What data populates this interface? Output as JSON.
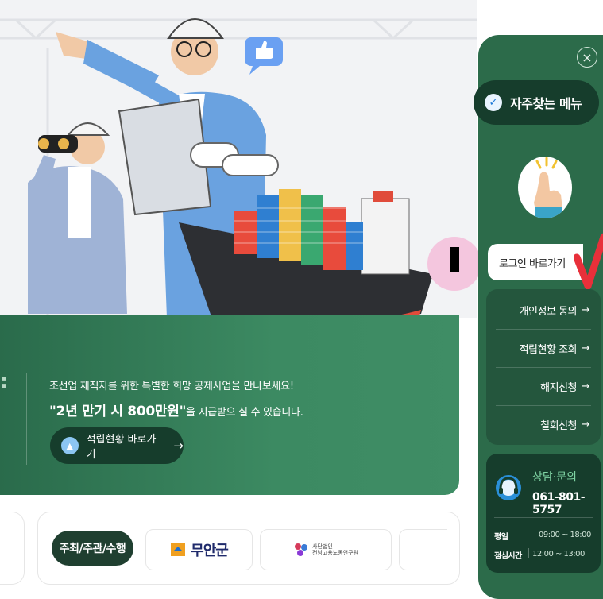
{
  "hero": {
    "line1": "조선업 재직자를 위한 특별한 희망 공제사업을 만나보세요!",
    "line2_bold": "\"2년 만기 시 800만원\"",
    "line2_rest": "을 지급받으 실 수 있습니다.",
    "status_button": "적립현황 바로가기",
    "status_arrow": "→",
    "quote_mark": ":"
  },
  "partners": {
    "label": "주최/주관/수행",
    "muan_logo": "무안군",
    "jeonnam_logo_small": "사단법인",
    "jeonnam_logo": "전남고용노동연구원"
  },
  "sidebar": {
    "close": "×",
    "favorites_title": "자주찾는 메뉴",
    "check_icon": "✓",
    "login_button": "로그인 바로가기",
    "menu": [
      {
        "label": "개인정보 동의",
        "arrow": "→"
      },
      {
        "label": "적립현황 조회",
        "arrow": "→"
      },
      {
        "label": "해지신청",
        "arrow": "→"
      },
      {
        "label": "철회신청",
        "arrow": "→"
      }
    ],
    "contact": {
      "title": "상담·문의",
      "phone": "061-801-5757",
      "weekday_label": "평일",
      "weekday_hours": "09:00 ~ 18:00",
      "lunch_label": "점심시간",
      "lunch_hours": "12:00 ~ 13:00"
    }
  },
  "colors": {
    "banner_green": "#3c8a62",
    "sidebar_green": "#2c6b4a",
    "dark_green": "#163d2c",
    "accent_red": "#e8303a",
    "pink": "#f4c6de"
  },
  "icons": [
    "thumbs-up-icon",
    "check-icon",
    "close-icon",
    "headset-icon",
    "arrow-right-icon",
    "hand-pointer-icon"
  ]
}
